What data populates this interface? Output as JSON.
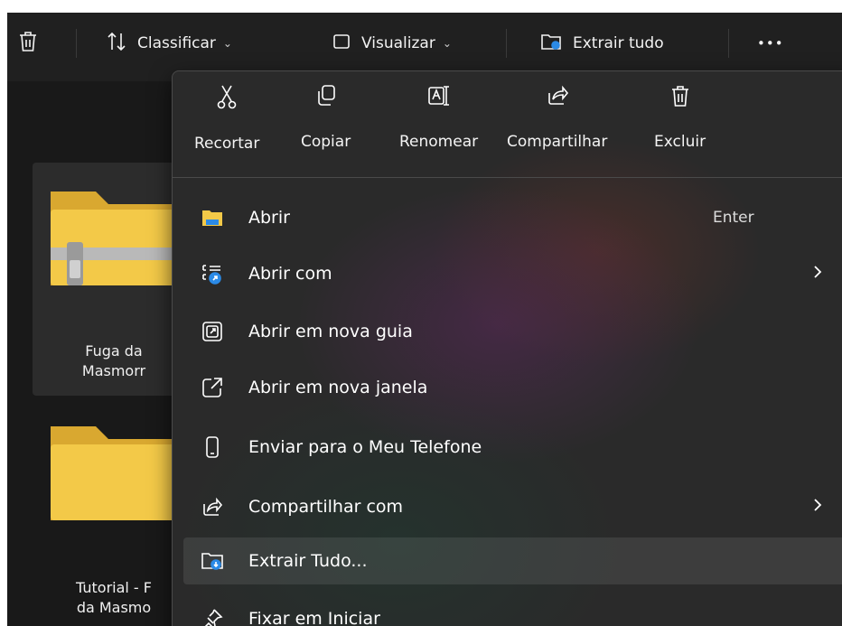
{
  "toolbar": {
    "sort_label": "Classificar",
    "view_label": "Visualizar",
    "extract_label": "Extrair tudo",
    "more_label": "•••"
  },
  "files": [
    {
      "name_line1": "Fuga da",
      "name_line2": "Masmorr"
    },
    {
      "name_line1": "Tutorial - F",
      "name_line2": "da Masmo"
    }
  ],
  "menu": {
    "quick_actions": [
      {
        "label": "Recortar",
        "icon": "scissors-icon"
      },
      {
        "label": "Copiar",
        "icon": "copy-icon"
      },
      {
        "label": "Renomear",
        "icon": "rename-icon"
      },
      {
        "label": "Compartilhar",
        "icon": "share-icon"
      },
      {
        "label": "Excluir",
        "icon": "trash-icon"
      }
    ],
    "items": [
      {
        "label": "Abrir",
        "shortcut": "Enter",
        "icon": "folder-open-icon"
      },
      {
        "label": "Abrir com",
        "icon": "open-with-icon"
      },
      {
        "label": "Abrir em nova guia",
        "icon": "new-tab-icon"
      },
      {
        "label": "Abrir em nova janela",
        "icon": "new-window-icon"
      },
      {
        "label": "Enviar para o Meu Telefone",
        "icon": "phone-icon"
      },
      {
        "label": "Compartilhar com",
        "icon": "share-with-icon"
      },
      {
        "label": "Extrair Tudo...",
        "icon": "extract-icon"
      },
      {
        "label": "Fixar em Iniciar",
        "icon": "pin-icon"
      }
    ]
  },
  "colors": {
    "window_bg": "#191919",
    "menu_bg": "#2a2a2a",
    "folder_yellow": "#f3c948",
    "accent_blue": "#2b8ae6"
  }
}
